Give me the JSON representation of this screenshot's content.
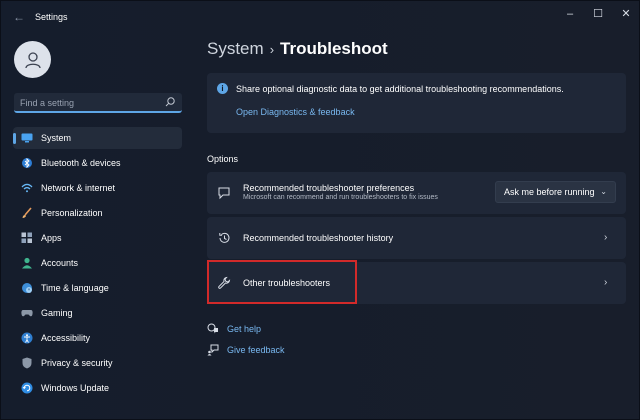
{
  "window": {
    "title": "Settings",
    "controls": {
      "minimize": "–",
      "maximize": "☐",
      "close": "✕"
    }
  },
  "sidebar": {
    "search": {
      "placeholder": "Find a setting",
      "value": ""
    },
    "items": [
      {
        "label": "System",
        "icon": "monitor-icon",
        "active": true
      },
      {
        "label": "Bluetooth & devices",
        "icon": "bluetooth-icon"
      },
      {
        "label": "Network & internet",
        "icon": "wifi-icon"
      },
      {
        "label": "Personalization",
        "icon": "brush-icon"
      },
      {
        "label": "Apps",
        "icon": "apps-icon"
      },
      {
        "label": "Accounts",
        "icon": "person-icon"
      },
      {
        "label": "Time & language",
        "icon": "globe-clock-icon"
      },
      {
        "label": "Gaming",
        "icon": "gamepad-icon"
      },
      {
        "label": "Accessibility",
        "icon": "accessibility-icon"
      },
      {
        "label": "Privacy & security",
        "icon": "shield-icon"
      },
      {
        "label": "Windows Update",
        "icon": "update-icon"
      }
    ]
  },
  "breadcrumb": {
    "parent": "System",
    "separator": "›",
    "current": "Troubleshoot"
  },
  "info": {
    "text": "Share optional diagnostic data to get additional troubleshooting recommendations.",
    "link": "Open Diagnostics & feedback"
  },
  "options": {
    "title": "Options",
    "rows": [
      {
        "title": "Recommended troubleshooter preferences",
        "subtitle": "Microsoft can recommend and run troubleshooters to fix issues",
        "dropdown": "Ask me before running",
        "icon": "chat-icon"
      },
      {
        "title": "Recommended troubleshooter history",
        "icon": "history-icon"
      },
      {
        "title": "Other troubleshooters",
        "icon": "wrench-icon",
        "highlighted": true
      }
    ]
  },
  "help": {
    "get_help": "Get help",
    "give_feedback": "Give feedback"
  },
  "colors": {
    "accent": "#5ea6e6",
    "link": "#79b8f0",
    "highlight_border": "#d22a2a"
  }
}
